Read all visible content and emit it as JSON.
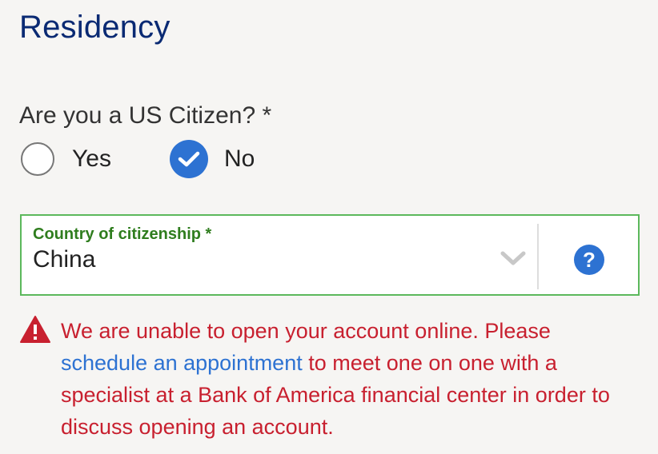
{
  "section": {
    "title": "Residency"
  },
  "citizenship_question": {
    "label": "Are you a US Citizen? *",
    "options": [
      {
        "label": "Yes",
        "selected": false
      },
      {
        "label": "No",
        "selected": true
      }
    ]
  },
  "country_field": {
    "label": "Country of citizenship *",
    "value": "China",
    "help_label": "?"
  },
  "error": {
    "text_before": "We are unable to open your account online. Please ",
    "link": "schedule an appointment",
    "text_after": " to meet one on one with a specialist at a Bank of America financial center in order to discuss opening an account."
  },
  "colors": {
    "title": "#0a2a73",
    "accent": "#2d72d2",
    "valid_border": "#5cb85c",
    "error": "#c8202f"
  },
  "icons": [
    "check-icon",
    "chevron-down-icon",
    "help-icon",
    "warning-icon"
  ]
}
